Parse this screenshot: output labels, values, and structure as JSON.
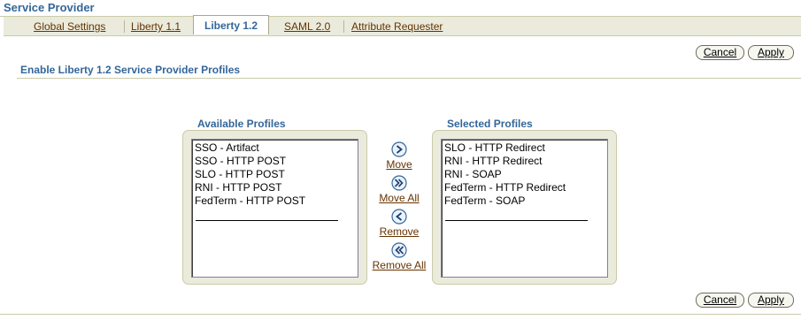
{
  "page": {
    "title": "Service Provider"
  },
  "tabs": [
    {
      "label": "Global Settings"
    },
    {
      "label": "Liberty 1.1"
    },
    {
      "label": "Liberty 1.2"
    },
    {
      "label": "SAML 2.0"
    },
    {
      "label": "Attribute Requester"
    }
  ],
  "active_tab": "Liberty 1.2",
  "buttons": {
    "cancel": "Cancel",
    "apply": "Apply"
  },
  "section": {
    "title": "Enable Liberty 1.2 Service Provider Profiles"
  },
  "available": {
    "title": "Available Profiles",
    "items": [
      "SSO - Artifact",
      "SSO - HTTP POST",
      "SLO - HTTP POST",
      "RNI - HTTP POST",
      "FedTerm - HTTP POST"
    ]
  },
  "selected": {
    "title": "Selected Profiles",
    "items": [
      "SLO - HTTP Redirect",
      "RNI - HTTP Redirect",
      "RNI - SOAP",
      "FedTerm - HTTP Redirect",
      "FedTerm - SOAP"
    ]
  },
  "shuttle": {
    "move": "Move",
    "move_all": "Move All",
    "remove": "Remove",
    "remove_all": "Remove All"
  },
  "icons": {
    "move": "move-right-icon",
    "move_all": "move-all-right-icon",
    "remove": "remove-left-icon",
    "remove_all": "remove-all-left-icon"
  },
  "colors": {
    "header_blue": "#336699",
    "link_brown": "#663300",
    "tab_bar": "#eaebdc",
    "frame_bg": "#eaebdc",
    "rule": "#c9cba8"
  }
}
